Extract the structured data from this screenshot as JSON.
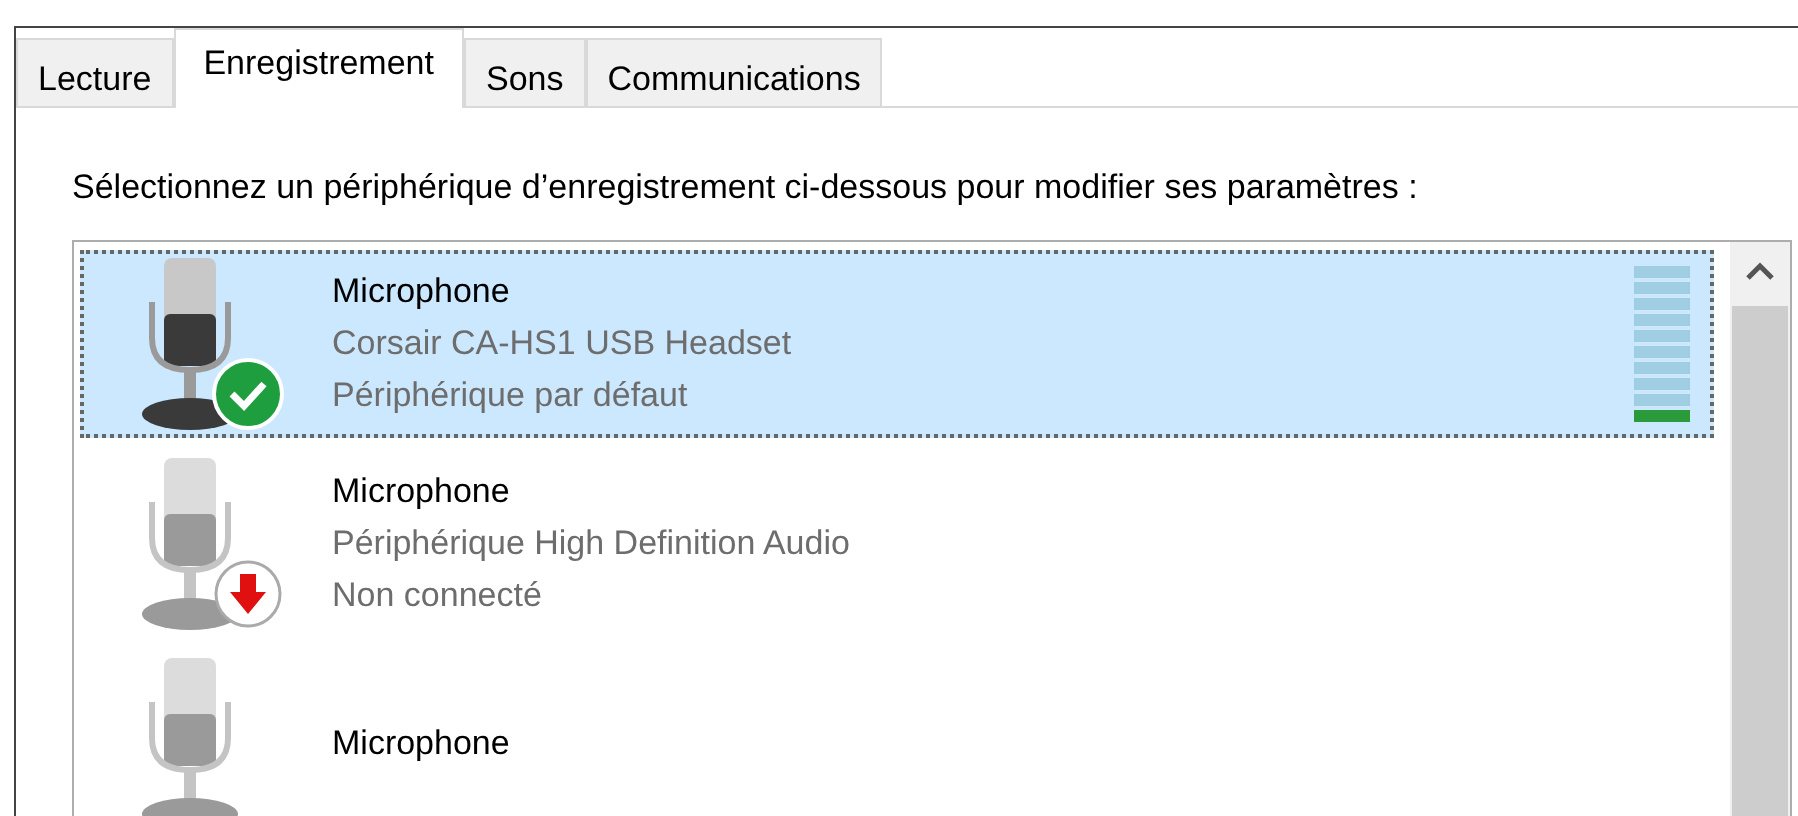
{
  "tabs": [
    {
      "label": "Lecture",
      "selected": false
    },
    {
      "label": "Enregistrement",
      "selected": true
    },
    {
      "label": "Sons",
      "selected": false
    },
    {
      "label": "Communications",
      "selected": false
    }
  ],
  "instruction": "Sélectionnez un périphérique d’enregistrement ci-dessous pour modifier ses paramètres :",
  "devices": [
    {
      "name": "Microphone",
      "description": "Corsair CA-HS1 USB Headset",
      "status": "Périphérique par défaut",
      "kind": "default",
      "selected": true,
      "level": 0.1
    },
    {
      "name": "Microphone",
      "description": "Périphérique High Definition Audio",
      "status": "Non connecté",
      "kind": "unplugged",
      "selected": false
    },
    {
      "name": "Microphone",
      "kind": "none",
      "selected": false
    }
  ]
}
